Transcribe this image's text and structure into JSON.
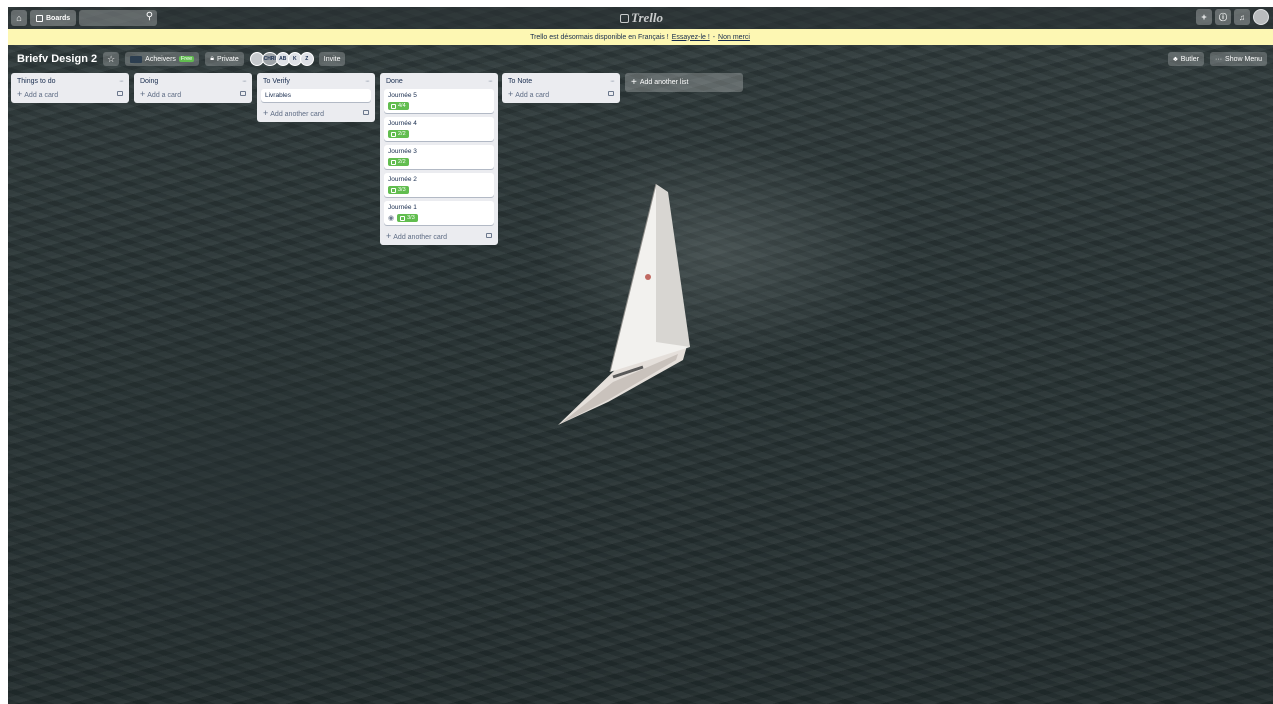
{
  "header": {
    "boards_label": "Boards",
    "search_placeholder": "",
    "logo_text": "Trello",
    "add_icon": "plus-icon",
    "info_icon": "info-icon",
    "bell_icon": "bell-icon"
  },
  "banner": {
    "message": "Trello est désormais disponible en Français !",
    "try_link": "Essayez-le !",
    "separator": "-",
    "dismiss_link": "Non merci"
  },
  "board": {
    "title": "Briefv Design 2",
    "team_label": "Acheivers",
    "team_badge": "Free",
    "visibility": "Private",
    "members": [
      "",
      "AB",
      "K",
      "Z"
    ],
    "photo_member": "CHRI",
    "invite_label": "Invite",
    "butler_label": "Butler",
    "show_menu_label": "Show Menu",
    "add_list_label": "Add another list"
  },
  "lists": [
    {
      "title": "Things to do",
      "add_label": "Add a card",
      "cards": []
    },
    {
      "title": "Doing",
      "add_label": "Add a card",
      "cards": []
    },
    {
      "title": "To Verify",
      "add_label": "Add another card",
      "cards": [
        {
          "title": "Livrables"
        }
      ]
    },
    {
      "title": "Done",
      "add_label": "Add another card",
      "cards": [
        {
          "title": "Journée 5",
          "checklist": "4/4"
        },
        {
          "title": "Journée 4",
          "checklist": "2/2"
        },
        {
          "title": "Journée 3",
          "checklist": "2/2"
        },
        {
          "title": "Journée 2",
          "checklist": "3/3"
        },
        {
          "title": "Journée 1",
          "checklist": "3/3",
          "watching": true
        }
      ]
    },
    {
      "title": "To Note",
      "add_label": "Add a card",
      "cards": []
    }
  ],
  "colors": {
    "banner": "#fdf7b3",
    "badge_green": "#61bd4f",
    "list_bg": "#ebecf0"
  }
}
